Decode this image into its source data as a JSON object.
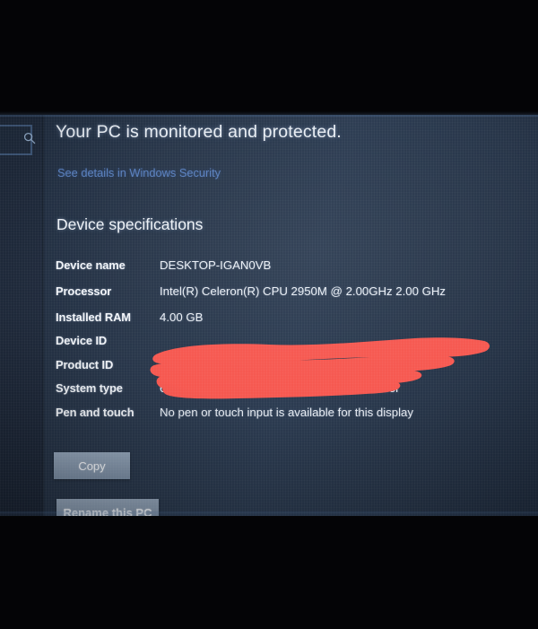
{
  "page": {
    "headline": "Your PC is monitored and protected.",
    "security_link": "See details in Windows Security",
    "section_title": "Device specifications"
  },
  "search": {
    "icon": "search-icon",
    "placeholder": ""
  },
  "specs": [
    {
      "label": "Device name",
      "value": "DESKTOP-IGAN0VB",
      "redacted": false
    },
    {
      "label": "Processor",
      "value": "Intel(R) Celeron(R) CPU 2950M @ 2.00GHz   2.00 GHz",
      "redacted": false
    },
    {
      "label": "Installed RAM",
      "value": "4.00 GB",
      "redacted": false
    },
    {
      "label": "Device ID",
      "value": "",
      "redacted": true
    },
    {
      "label": "Product ID",
      "value": "",
      "redacted": true
    },
    {
      "label": "System type",
      "value": "64-bit operating system, x64-based processor",
      "redacted": false
    },
    {
      "label": "Pen and touch",
      "value": "No pen or touch input is available for this display",
      "redacted": false
    }
  ],
  "buttons": {
    "copy": "Copy",
    "rename": "Rename this PC"
  },
  "colors": {
    "screen_background": "#263448",
    "nav_rail": "#1e293b",
    "text_primary": "#e9eef5",
    "link_blue": "#5c86c9",
    "button_face": "#8597ad",
    "redaction_red": "#f6564e",
    "letterbox_black": "#040406"
  }
}
